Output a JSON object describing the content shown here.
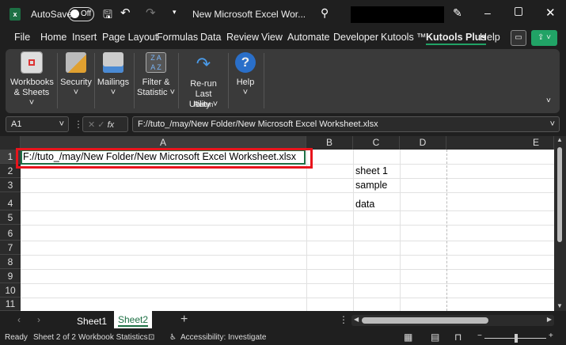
{
  "titlebar": {
    "autosave_label": "AutoSave",
    "autosave_state": "Off",
    "doc_title": "New Microsoft Excel Wor...",
    "app_icon": "excel-icon"
  },
  "menu": [
    "File",
    "Home",
    "Insert",
    "Page Layout",
    "Formulas",
    "Data",
    "Review",
    "View",
    "Automate",
    "Developer",
    "Kutools ™",
    "Kutools Plus",
    "Help"
  ],
  "active_tab": "Kutools Plus",
  "ribbon": {
    "groups": [
      {
        "label1": "Workbooks",
        "label2": "& Sheets ˅"
      },
      {
        "label1": "Security",
        "label2": "˅"
      },
      {
        "label1": "Mailings",
        "label2": "˅"
      },
      {
        "label1": "Filter &",
        "label2": "Statistic ˅"
      },
      {
        "label1": "Re-run Last",
        "label2": "Utility ˅"
      },
      {
        "label1": "Help",
        "label2": "˅"
      }
    ],
    "rerun_group": "Rerun"
  },
  "formula_bar": {
    "name_box": "A1",
    "fx": "fx",
    "value": "F://tuto_/may/New Folder/New Microsoft Excel Worksheet.xlsx"
  },
  "columns": [
    "A",
    "B",
    "C",
    "D",
    "E"
  ],
  "rows": [
    "1",
    "2",
    "3",
    "4",
    "5",
    "6",
    "7",
    "8",
    "9",
    "10",
    "11"
  ],
  "cells": {
    "A1": "F://tuto_/may/New Folder/New Microsoft Excel Worksheet.xlsx",
    "C2": "sheet 1",
    "C3": "sample",
    "C4": "data"
  },
  "sheets": [
    "Sheet1",
    "Sheet2"
  ],
  "active_sheet": "Sheet2",
  "status": {
    "ready": "Ready",
    "sheet_pos": "Sheet 2 of 2",
    "stats": "Workbook Statistics",
    "accessibility": "Accessibility: Investigate"
  },
  "colors": {
    "accent": "#21a366",
    "highlight": "#e8141c"
  }
}
